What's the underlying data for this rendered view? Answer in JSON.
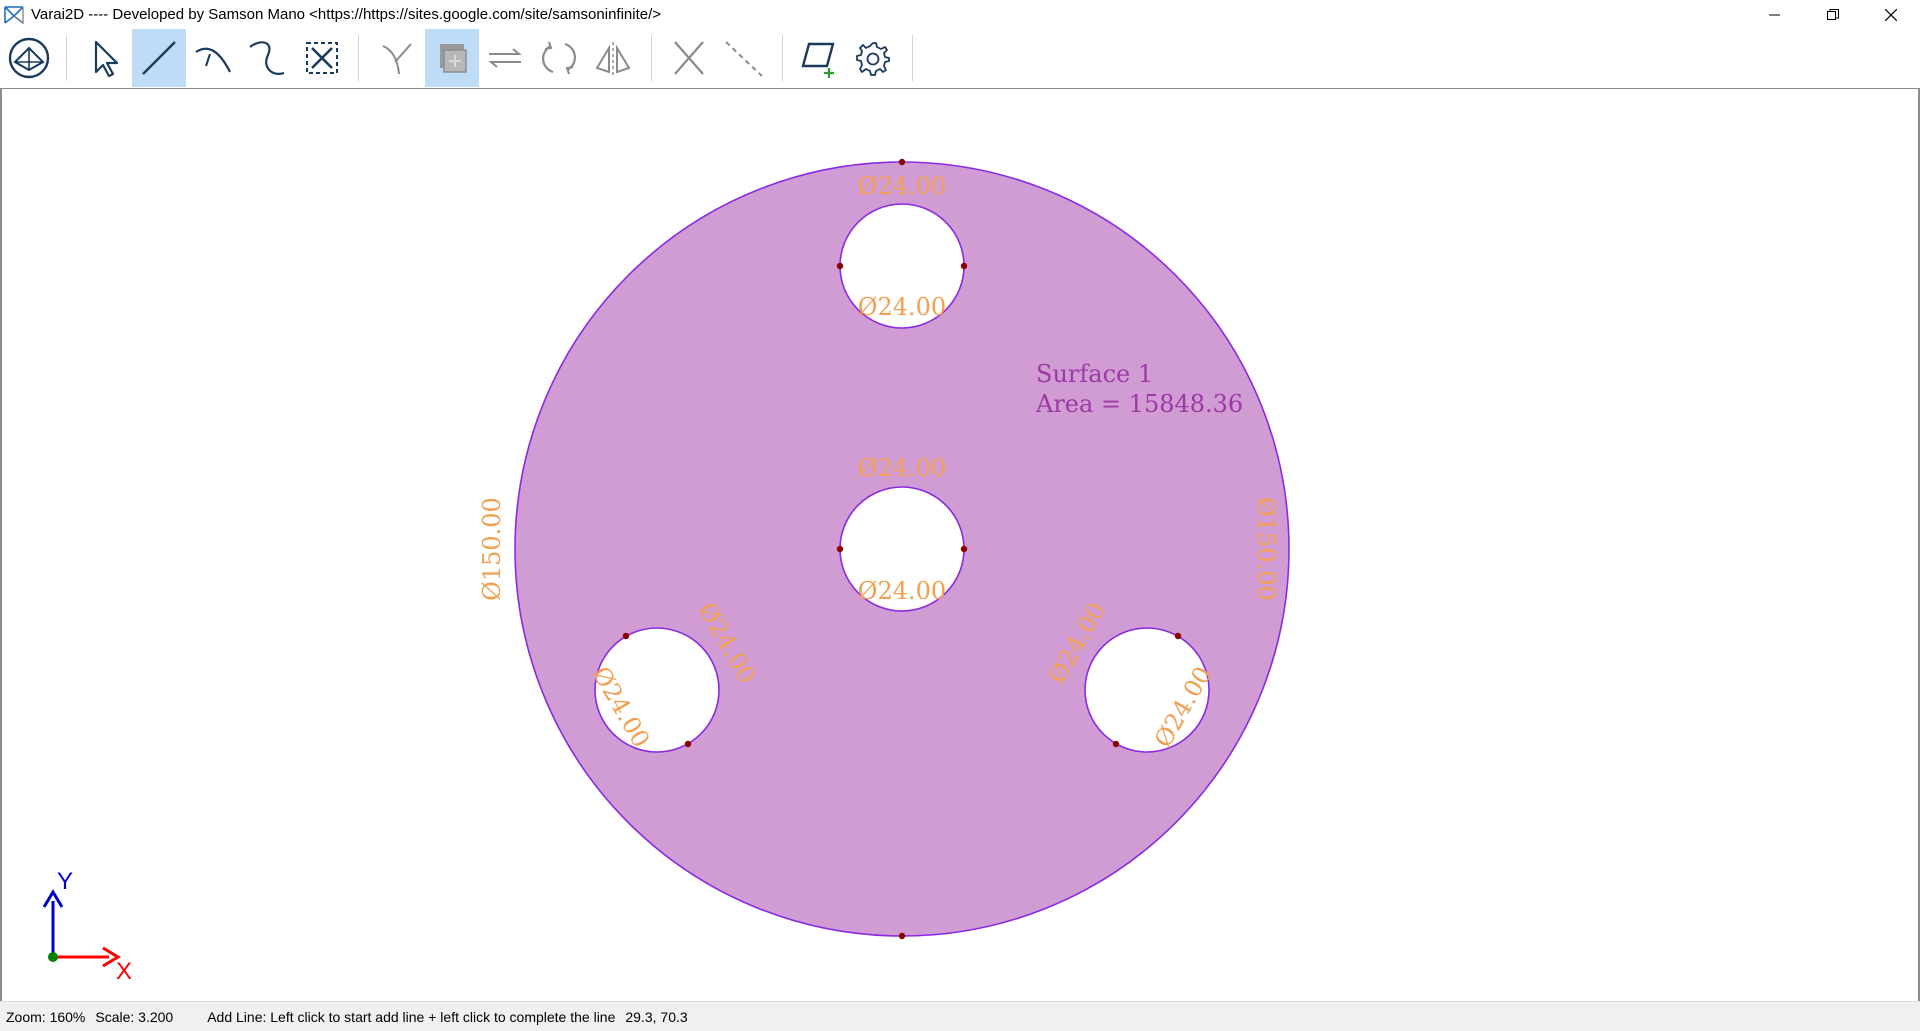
{
  "window": {
    "title": "Varai2D ---- Developed by Samson Mano <https://https://sites.google.com/site/samsoninfinite/>"
  },
  "toolbar": {
    "tools": [
      {
        "name": "home-view",
        "icon": "home-view-icon"
      },
      {
        "name": "select",
        "icon": "pointer-icon"
      },
      {
        "name": "add-line",
        "icon": "line-icon",
        "active": true
      },
      {
        "name": "add-arc",
        "icon": "arc-icon"
      },
      {
        "name": "add-spline",
        "icon": "spline-icon"
      },
      {
        "name": "fit-to-view",
        "icon": "zoom-fit-icon"
      },
      {
        "name": "trim",
        "icon": "trim-icon"
      },
      {
        "name": "add-surface",
        "icon": "surface-icon",
        "active": true
      },
      {
        "name": "translate",
        "icon": "translate-icon"
      },
      {
        "name": "rotate",
        "icon": "rotate-icon"
      },
      {
        "name": "mirror",
        "icon": "mirror-icon"
      },
      {
        "name": "delete",
        "icon": "delete-icon"
      },
      {
        "name": "construction-line",
        "icon": "dashed-line-icon"
      },
      {
        "name": "add-material",
        "icon": "add-material-icon"
      },
      {
        "name": "settings",
        "icon": "gear-icon"
      }
    ]
  },
  "canvas": {
    "surface_label": "Surface 1",
    "area_label": "Area = 15848.36",
    "outer_dimension": "Ø150.00",
    "hole_dimension": "Ø24.00",
    "axis_x": "X",
    "axis_y": "Y",
    "colors": {
      "surface_fill": "#d19bd3",
      "boundary": "#8a2be2",
      "dimension": "#f0a050",
      "node": "#8b0000",
      "surface_text": "#9b3aa6",
      "axis_x": "#ff0000",
      "axis_y": "#0000cc",
      "origin": "#008000"
    }
  },
  "status": {
    "zoom": "Zoom: 160%",
    "scale": "Scale: 3.200",
    "message": "Add Line: Left click to start add line + left click to complete the line",
    "coordinates": "29.3, 70.3"
  }
}
